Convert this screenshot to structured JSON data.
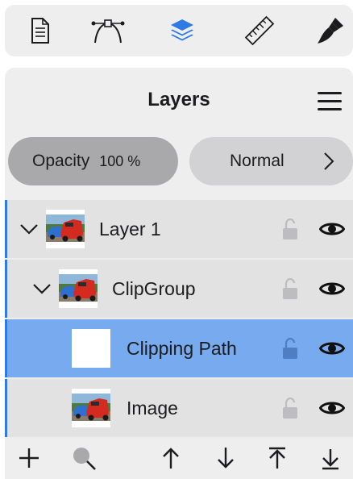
{
  "toolbar": {
    "tools": [
      {
        "name": "document-icon",
        "active": false
      },
      {
        "name": "vector-pen-icon",
        "active": false
      },
      {
        "name": "layers-icon",
        "active": true
      },
      {
        "name": "ruler-icon",
        "active": false
      },
      {
        "name": "brush-icon",
        "active": false
      }
    ],
    "accent_color": "#2f7ae5"
  },
  "panel": {
    "title": "Layers",
    "opacity_label": "Opacity",
    "opacity_value": "100 %",
    "blend_mode": "Normal"
  },
  "layers": [
    {
      "name": "Layer 1",
      "expanded": true,
      "thumbnail": "car-photo",
      "locked": false,
      "visible": true,
      "selected": false
    },
    {
      "name": "ClipGroup",
      "expanded": true,
      "thumbnail": "car-photo",
      "locked": false,
      "visible": true,
      "selected": false
    },
    {
      "name": "Clipping Path",
      "expanded": false,
      "thumbnail": "white-shape",
      "locked": false,
      "visible": true,
      "selected": true
    },
    {
      "name": "Image",
      "expanded": false,
      "thumbnail": "car-photo",
      "locked": false,
      "visible": true,
      "selected": false
    }
  ],
  "bottom_actions": [
    {
      "name": "add-layer-icon"
    },
    {
      "name": "search-icon"
    },
    {
      "name": "move-up-icon"
    },
    {
      "name": "move-down-icon"
    },
    {
      "name": "move-to-top-icon"
    },
    {
      "name": "move-to-bottom-icon"
    }
  ]
}
